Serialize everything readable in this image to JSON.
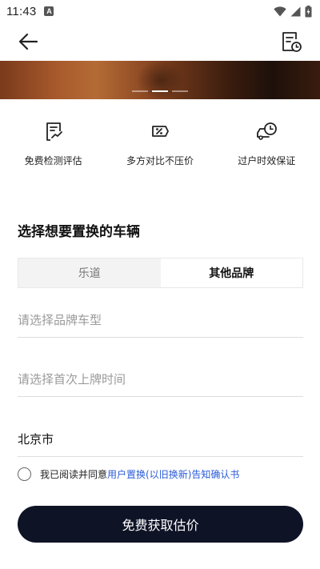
{
  "status_bar": {
    "time": "11:43",
    "a_icon": "A"
  },
  "app_bar": {
    "back_icon": "arrow-left-icon",
    "history_icon": "document-clock-icon"
  },
  "banner": {
    "page_count": 3,
    "active_index": 1
  },
  "features": [
    {
      "label": "免费检测评估",
      "icon": "inspection-clipboard-icon"
    },
    {
      "label": "多方对比不压价",
      "icon": "percent-tag-icon"
    },
    {
      "label": "过户时效保证",
      "icon": "car-clock-icon"
    }
  ],
  "section_title": "选择想要置换的车辆",
  "tabs": [
    {
      "label": "乐道",
      "active": false
    },
    {
      "label": "其他品牌",
      "active": true
    }
  ],
  "form": {
    "brand_model_placeholder": "请选择品牌车型",
    "first_registration_placeholder": "请选择首次上牌时间",
    "city_value": "北京市"
  },
  "agreement": {
    "prefix": "我已阅读并同意 ",
    "link": "用户置换(以旧换新)告知确认书"
  },
  "submit_label": "免费获取估价",
  "colors": {
    "primary_button": "#0f1326",
    "link": "#2a5bd7"
  }
}
